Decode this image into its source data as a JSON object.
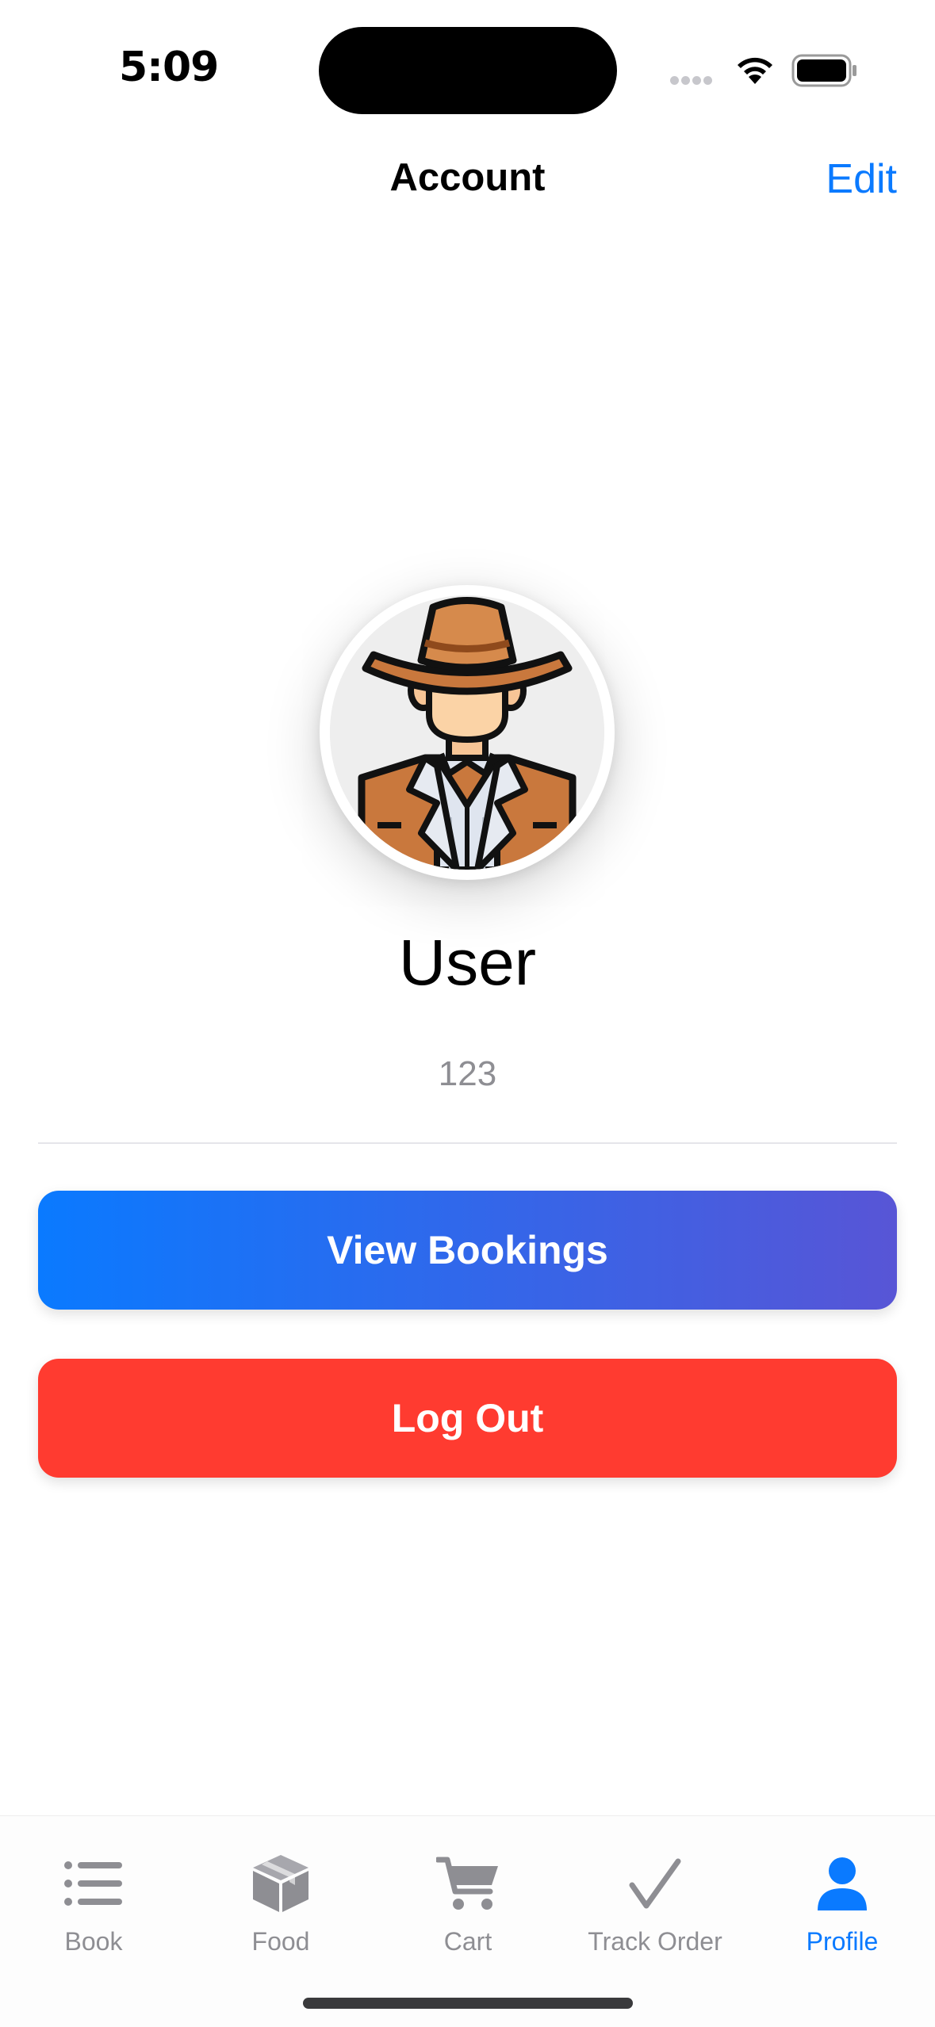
{
  "status": {
    "time": "5:09"
  },
  "nav": {
    "title": "Account",
    "edit_label": "Edit"
  },
  "profile": {
    "name": "User",
    "id": "123",
    "avatar": "cowboy-avatar"
  },
  "actions": {
    "view_bookings": "View Bookings",
    "log_out": "Log Out"
  },
  "colors": {
    "accent": "#0a7aff",
    "gradient_end": "#5855d6",
    "danger": "#ff3b30",
    "muted": "#8e8e93"
  },
  "tabs": [
    {
      "label": "Book",
      "icon": "list-icon",
      "active": false
    },
    {
      "label": "Food",
      "icon": "box-icon",
      "active": false
    },
    {
      "label": "Cart",
      "icon": "cart-icon",
      "active": false
    },
    {
      "label": "Track Order",
      "icon": "checkmark-icon",
      "active": false
    },
    {
      "label": "Profile",
      "icon": "person-icon",
      "active": true
    }
  ]
}
